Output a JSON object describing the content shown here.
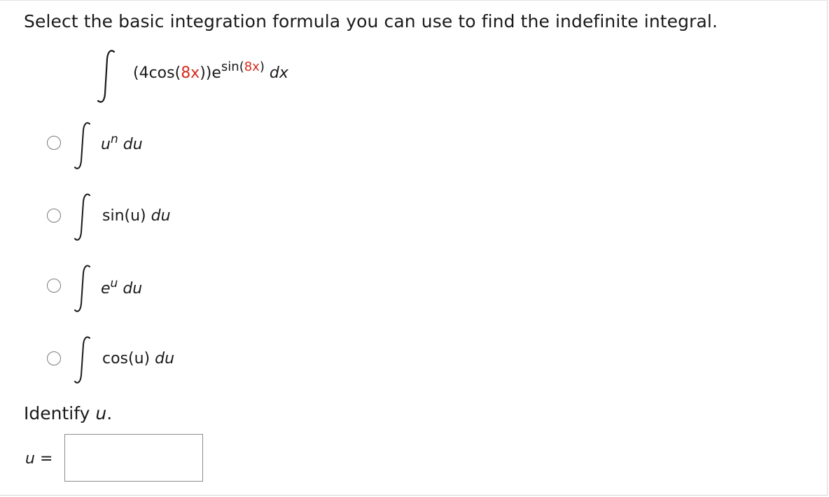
{
  "question": "Select the basic integration formula you can use to find the indefinite integral.",
  "integral": {
    "open": "(4cos(",
    "inner1": "8x",
    "mid": "))e",
    "sup_prefix": "sin(",
    "sup_inner": "8x",
    "sup_suffix": ")",
    "dx": " dx"
  },
  "options": [
    {
      "base": "u",
      "sup": "n",
      "du": " du"
    },
    {
      "text": "sin(u)",
      "du": " du"
    },
    {
      "base": "e",
      "sup": "u",
      "du": " du"
    },
    {
      "text": "cos(u)",
      "du": " du"
    }
  ],
  "identify": {
    "label": "Identify ",
    "var": "u",
    "period": "."
  },
  "answer": {
    "label": "u",
    "equals": " =",
    "value": ""
  },
  "colors": {
    "highlight": "#d62a1e",
    "radio_border": "#7a7a7a",
    "box_border": "#8c8c8c"
  }
}
